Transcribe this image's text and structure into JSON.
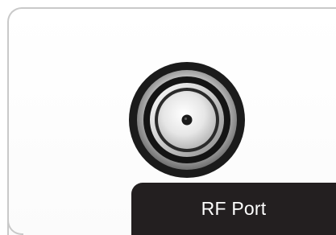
{
  "label": {
    "text": "RF Port"
  },
  "port": {
    "icon": "rf-coaxial-connector-icon"
  },
  "colors": {
    "tab_background": "#231f20",
    "tab_text": "#ffffff",
    "card_border": "#c9c9c9"
  }
}
